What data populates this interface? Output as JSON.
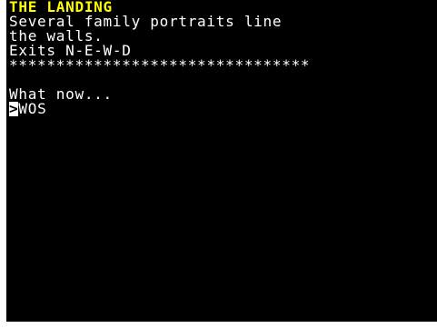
{
  "colors": {
    "background": "#000000",
    "text": "#ffffff",
    "title": "#ffff00",
    "outer_border": "#ffffff"
  },
  "game": {
    "location_title": "THE LANDING",
    "description_line_1": "Several family portraits line",
    "description_line_2": "the walls.",
    "exits_line": "Exits N-E-W-D",
    "separator": "********************************",
    "prompt": "What now...",
    "cursor_glyph": ">",
    "input_text": "WOS"
  }
}
